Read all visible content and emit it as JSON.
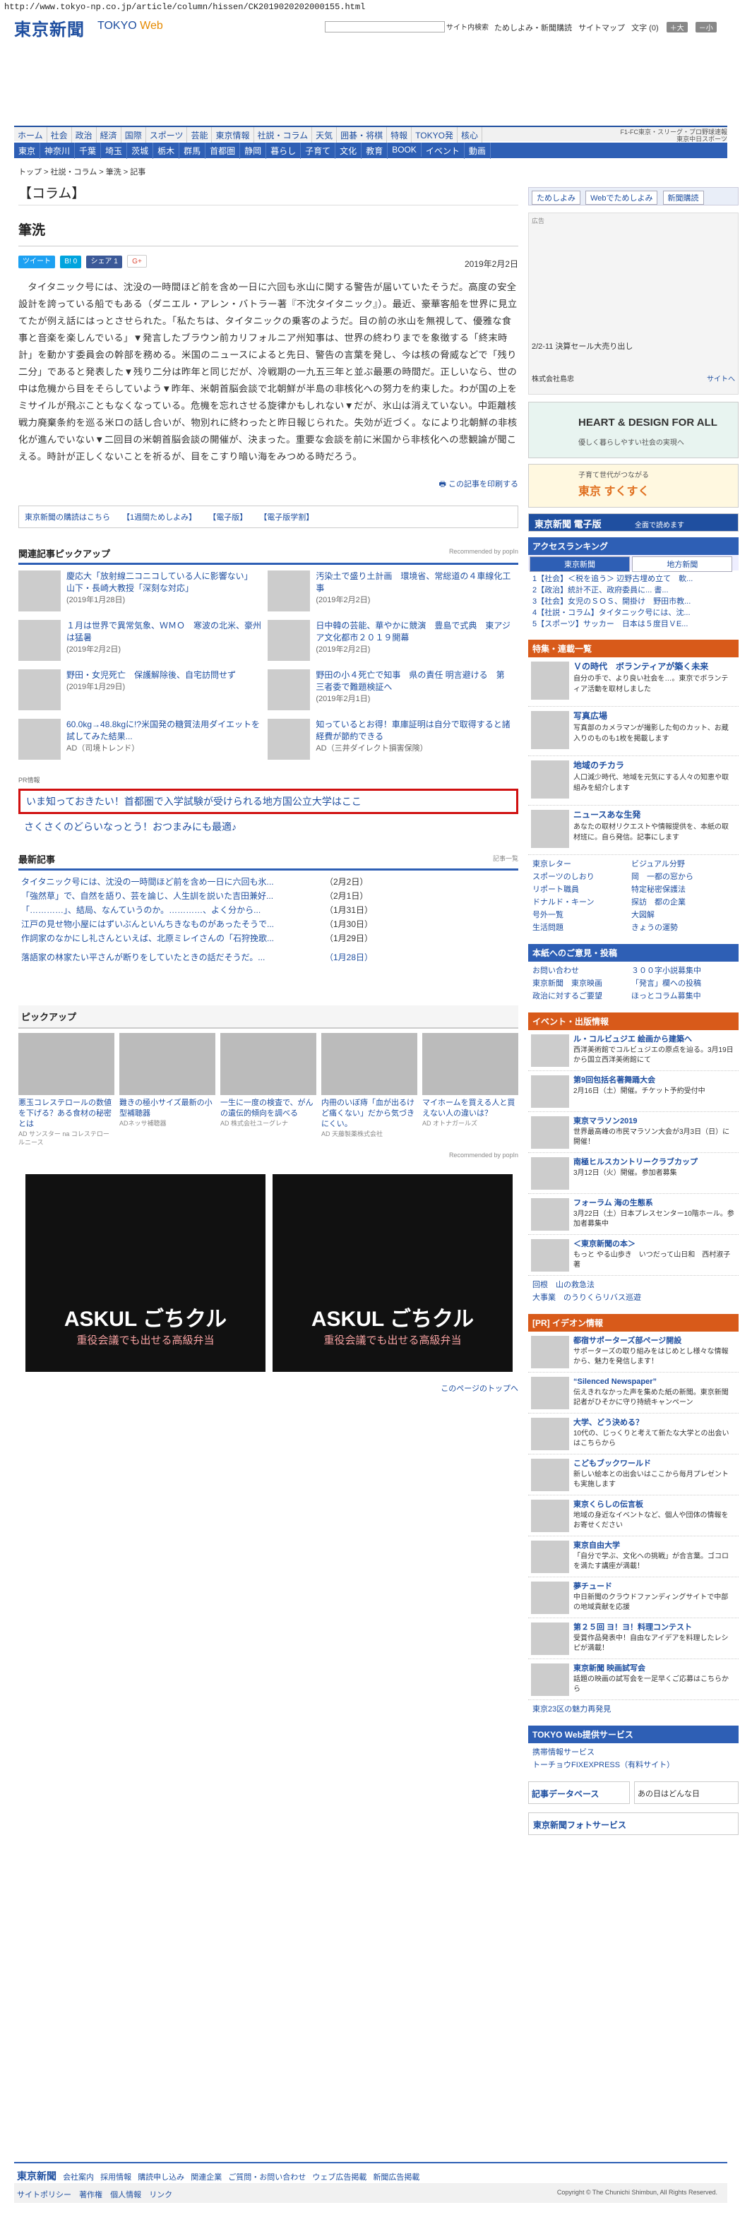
{
  "url": "http://www.tokyo-np.co.jp/article/column/hissen/CK2019020202000155.html",
  "header": {
    "logo": "東京新聞",
    "logo_sub": "TOKYO",
    "logo_web": "Web",
    "search_button": "サイト内検索",
    "links": [
      "ためしよみ・新聞購読",
      "サイトマップ",
      "文字 (0)"
    ],
    "font_plus": "＋大",
    "font_minus": "－小"
  },
  "nav1": [
    "ホーム",
    "社会",
    "政治",
    "経済",
    "国際",
    "スポーツ",
    "芸能",
    "東京情報",
    "社説・コラム",
    "天気",
    "囲碁・将棋",
    "特報",
    "TOKYO発",
    "核心"
  ],
  "nav1_right": [
    "F1-FC東京・スリーグ・プロ野球速報",
    "東京中日スポーツ"
  ],
  "nav2": [
    "東京",
    "神奈川",
    "千葉",
    "埼玉",
    "茨城",
    "栃木",
    "群馬",
    "首都圏",
    "静岡",
    "暮らし",
    "子育て",
    "文化",
    "教育",
    "BOOK",
    "イベント",
    "動画"
  ],
  "breadcrumb": "トップ > 社説・コラム > 筆洗 > 記事",
  "section_title": "【コラム】",
  "article": {
    "title": "筆洗",
    "share": [
      "ツイート",
      "B! 0",
      "シェア 1",
      "G+"
    ],
    "date": "2019年2月2日",
    "body": "タイタニック号には、沈没の一時間ほど前を含め一日に六回も氷山に関する警告が届いていたそうだ。高度の安全設計を誇っている船でもある（ダニエル・アレン・バトラー著『不沈タイタニック』）。最近、豪華客船を世界に見立てたが例え話にはっとさせられた。「私たちは、タイタニックの乗客のようだ。目の前の氷山を無視して、優雅な食事と音楽を楽しんでいる」▼発言したブラウン前カリフォルニア州知事は、世界の終わりまでを象徴する「終末時計」を動かす委員会の幹部を務める。米国のニュースによると先日、警告の言葉を発し、今は核の脅威などで「残り二分」であると発表した▼残り二分は昨年と同じだが、冷戦期の一九五三年と並ぶ最悪の時間だ。正しいなら、世の中は危機から目をそらしていよう▼昨年、米朝首脳会談で北朝鮮が半島の非核化への努力を約束した。わが国の上をミサイルが飛ぶこともなくなっている。危機を忘れさせる旋律かもしれない▼だが、氷山は消えていない。中距離核戦力廃棄条約を巡る米ロの話し合いが、物別れに終わったと昨日報じられた。失効が近づく。なにより北朝鮮の非核化が進んでいない▼二回目の米朝首脳会談の開催が、決まった。重要な会談を前に米国から非核化への悲観論が聞こえる。時計が正しくないことを祈るが、目をこすり暗い海をみつめる時だろう。",
    "print": "この記事を印刷する"
  },
  "linkbox": [
    "東京新聞の購読はこちら",
    "【1週間ためしよみ】",
    "【電子版】",
    "【電子版学割】"
  ],
  "related": {
    "head": "関連記事ピックアップ",
    "rec": "Recommended by popIn",
    "items": [
      {
        "title": "慶応大「放射線二コニコしている人に影響ない」　山下・長崎大教授「深刻な対応」",
        "date": "(2019年1月28日)"
      },
      {
        "title": "汚染土で盛り土計画　環境省、常総道の４車線化工事",
        "date": "(2019年2月2日)"
      },
      {
        "title": "１月は世界で異常気象、ＷＭＯ　寒波の北米、豪州は猛暑",
        "date": "(2019年2月2日)"
      },
      {
        "title": "日中韓の芸能、華やかに競演　豊島で式典　東アジア文化都市２０１９開幕",
        "date": "(2019年2月2日)"
      },
      {
        "title": "野田・女児死亡　保護解除後、自宅訪問せず",
        "date": "(2019年1月29日)"
      },
      {
        "title": "野田の小４死亡で知事　県の責任 明言避ける　第三者委で難題検証へ",
        "date": "(2019年2月1日)"
      },
      {
        "title": "60.0kg→48.8kgに!?米国発の糖質法用ダイエットを試してみた結果...",
        "date": "AD（司境トレンド）"
      },
      {
        "title": "知っているとお得！車庫証明は自分で取得すると諸経費が節約できる",
        "date": "AD（三井ダイレクト損害保険）"
      }
    ]
  },
  "pr": {
    "label": "PR情報",
    "item1": "いま知っておきたい！首都圏で入学試験が受けられる地方国公立大学はここ",
    "item2": "さくさくのどらいなっとう！おつまみにも最適♪"
  },
  "latest": {
    "head": "最新記事",
    "more_btn": "記事一覧",
    "items": [
      {
        "t": "タイタニック号には、沈没の一時間ほど前を含め一日に六回も氷...",
        "d": "（2月2日）"
      },
      {
        "t": "「強然草」で、自然を語り、芸を論じ、人生訓を説いた吉田兼好...",
        "d": "（2月1日）"
      },
      {
        "t": "「…………」、結局、なんていうのか。…………、よく分から...",
        "d": "（1月31日）"
      },
      {
        "t": "江戸の見せ物小屋にはずいぶんといんちきなものがあったそうで...",
        "d": "（1月30日）"
      },
      {
        "t": "作詞家のなかにし礼さんといえば、北原ミレイさんの「石狩挽歌...",
        "d": "（1月29日）"
      },
      {
        "t": "落語家の林家たい平さんが断りをしていたときの話だそうだ。...",
        "d": "（1月28日）"
      }
    ]
  },
  "pickup": {
    "head": "ピックアップ",
    "items": [
      {
        "t": "悪玉コレステロールの数値を下げる？ある食材の秘密とは",
        "ad": "AD サンスター na コレステロールニース"
      },
      {
        "t": "難きの極小サイズ最新の小型補聴器",
        "ad": "ADネッサ補聴器"
      },
      {
        "t": "一生に一度の検査で、がんの遺伝的傾向を調べる",
        "ad": "AD 株式会社ユーグレナ"
      },
      {
        "t": "内冊のいぼ痔「血が出るけど痛くない」だから気づきにくい。",
        "ad": "AD 天藤製薬株式会社"
      },
      {
        "t": "マイホームを買える人と買えない人の違いは？",
        "ad": "AD オトナガールズ"
      }
    ],
    "rec": "Recommended by popIn"
  },
  "askul": {
    "title": "ASKUL ごちクル",
    "sub": "重役会議でも出せる高級弁当"
  },
  "toplink": "このページのトップへ",
  "sidebar": {
    "top_btns": [
      "ためしよみ",
      "Webでためしよみ",
      "新聞購読"
    ],
    "ad_caption": "2/2-11 決算セール大売り出し",
    "ad_label": "広告",
    "ad_company": "株式会社島忠",
    "ad_site": "サイトへ",
    "banners": [
      {
        "t": "HEART & DESIGN FOR ALL",
        "s": "優しく暮らしやすい社会の実現へ"
      },
      {
        "t": "東京 すくすく",
        "s": "子育て世代がつながる"
      },
      {
        "t": "東京新聞 電子版",
        "s": "全面で読めます"
      }
    ],
    "ranking": {
      "head": "アクセスランキング",
      "tabs": [
        "東京新聞",
        "地方新聞"
      ],
      "items": [
        "1【社会】＜税を追う＞ 辺野古埋め立て　軟...",
        "2【政治】統計不正、政府委員に... 書...",
        "3【社会】女児のＳＯＳ、開掛け　野田市教...",
        "4【社説・コラム】タイタニック号には、沈...",
        "5【スポーツ】サッカー　日本は５度目ＶE..."
      ]
    },
    "feature": {
      "head": "特集・連載一覧",
      "items": [
        {
          "t": "Ｖの時代　ボランティアが築く未来",
          "s": "自分の手で、より良い社会を…。東京でボランティア活動を取材しました"
        },
        {
          "t": "写真広場",
          "s": "写真部のカメラマンが撮影した旬のカット、お蔵入りのものも1枚を掲載します"
        },
        {
          "t": "地域のチカラ",
          "s": "人口減少時代、地域を元気にする人々の知恵や取組みを紹介します"
        },
        {
          "t": "ニュースあな生発",
          "s": "あなたの取材リクエストや情報提供を、本紙の取材班に。自ら発信。記事にします"
        }
      ],
      "links": [
        "東京レター",
        "ビジュアル分野",
        "スポーツのしおり",
        "岡　一都の窓から",
        "リポート職員",
        "特定秘密保護法",
        "ドナルド・キーン",
        "探訪　都の企業",
        "号外一覧",
        "大図解",
        "生活問題",
        "きょうの運勢"
      ]
    },
    "contact": {
      "head": "本紙へのご意見・投稿",
      "links": [
        "お問い合わせ",
        "３００字小説募集中",
        "東京新聞　東京映画",
        "「発言」欄への投稿",
        "政治に対するご要望",
        "ほっとコラム募集中"
      ]
    },
    "events": {
      "head": "イベント・出版情報",
      "items": [
        {
          "t": "ル・コルビュジエ 絵画から建築へ",
          "s": "西洋美術館でコルビュジエの原点を辿る。3月19日から国立西洋美術館にて"
        },
        {
          "t": "第9回包括名著舞踊大会",
          "s": "2月16日（土）開催。チケット予約受付中"
        },
        {
          "t": "東京マラソン2019",
          "s": "世界最高峰の市民マラソン大会が3月3日（日）に開催！"
        },
        {
          "t": "南極ヒルスカントリークラブカップ",
          "s": "3月12日（火）開催。参加者募集"
        },
        {
          "t": "フォーラム 海の生態系",
          "s": "3月22日（土）日本プレスセンター10階ホール。参加者募集中"
        },
        {
          "t": "＜東京新聞の本＞",
          "s": "もっと やる山歩き　いつだって山日和　西村淑子 著"
        }
      ],
      "extra": [
        "回根　山の救急法",
        "大事業　のうりくらリバス巡遊"
      ]
    },
    "ion": {
      "head": "[PR] イデオン情報",
      "items": [
        {
          "t": "都宿サポーターズ部ページ開設",
          "s": "サポーターズの取り組みをはじめとし様々な情報から、魅力を発信します！"
        },
        {
          "t": "“Silenced Newspaper”",
          "s": "伝えきれなかった声を集めた紙の新聞。東京新聞記者がひそかに守り持続キャンペーン"
        },
        {
          "t": "大学、どう決める？",
          "s": "10代の、じっくりと考えて新たな大学との出会いはこちらから"
        },
        {
          "t": "こどもブックワールド",
          "s": "新しい絵本との出会いはここから毎月プレゼントも実施します"
        },
        {
          "t": "東京くらしの伝言板",
          "s": "地域の身近なイベントなど、個人や団体の情報をお寄せください"
        },
        {
          "t": "東京自由大学",
          "s": "「自分で学ぶ、文化への挑戦」が合言葉。ゴコロを満たす講座が満載！"
        },
        {
          "t": "夢チュード",
          "s": "中日新聞のクラウドファンディングサイトで中部の地域貢献を応援"
        },
        {
          "t": "第２５回 ヨ！ヨ！料理コンテスト",
          "s": "受賞作品発表中！自由なアイデアを料理したレシピが満載！"
        },
        {
          "t": "東京新聞 映画試写会",
          "s": "話題の映画の試写会を一足早くご応募はこちらから"
        }
      ],
      "extra": "東京23区の魅力再発見"
    },
    "service": {
      "head": "TOKYO Web提供サービス",
      "links": [
        "携帯情報サービス",
        "トーチョウFIXEXPRESS（有料サイト）"
      ]
    },
    "bottom": [
      "記事データベース",
      "あの日はどんな日",
      "東京新聞フォトサービス"
    ]
  },
  "footer": {
    "logo": "東京新聞",
    "links": [
      "会社案内",
      "採用情報",
      "購読申し込み",
      "関連企業",
      "ご質問・お問い合わせ",
      "ウェブ広告掲載",
      "新聞広告掲載"
    ],
    "bar": [
      "サイトポリシー",
      "著作権",
      "個人情報",
      "リンク"
    ],
    "copyright": "Copyright © The Chunichi Shimbun, All Rights Reserved."
  },
  "colors": {
    "brand": "#1f4fa0",
    "nav": "#2e5fb5",
    "pr_border": "#d01010",
    "accent": "#d85a1a"
  }
}
